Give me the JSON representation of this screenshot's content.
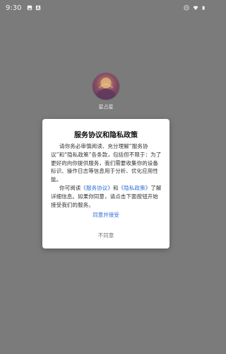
{
  "status_bar": {
    "time": "9:30",
    "left_icons": [
      "image-icon",
      "a-icon"
    ],
    "right_icons": [
      "do-not-disturb-icon",
      "wifi-icon",
      "battery-icon"
    ]
  },
  "splash": {
    "app_name": "星占星",
    "logo_icon": "app-logo-icon"
  },
  "dialog": {
    "title": "服务协议和隐私政策",
    "para1": "请你务必审慎阅读、充分理解“服务协议”和“隐私政策”各条款，包括但不限于：为了更好的向你提供服务，我们需要收集你的设备标识、操作日志等信息用于分析、优化应用性能。",
    "para2_prefix": "你可阅读",
    "service_link": "《服务协议》",
    "para2_and": "和",
    "privacy_link": "《隐私政策》",
    "para2_suffix": "了解详细信息。如果你同意，请点击下面按钮开始接受我们的服务。",
    "accept_label": "同意并接受",
    "decline_label": "不同意"
  },
  "colors": {
    "backdrop": "#7b7b7b",
    "link": "#2f6fd6",
    "dialog_bg": "#ffffff"
  }
}
